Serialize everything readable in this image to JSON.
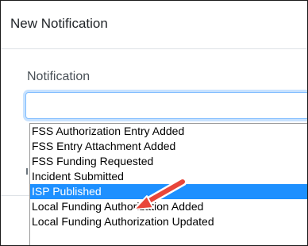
{
  "modal": {
    "title": "New Notification"
  },
  "form": {
    "notification_label": "Notification",
    "notification_value": ""
  },
  "dropdown": {
    "options": [
      "FSS Authorization Entry Added",
      "FSS Entry Attachment Added",
      "FSS Funding Requested",
      "Incident Submitted",
      "ISP Published",
      "Local Funding Authorization Added",
      "Local Funding Authorization Updated"
    ],
    "selected": "ISP Published"
  },
  "colors": {
    "highlight": "#1e90ff",
    "annotation_arrow": "#e8463a",
    "focus_border": "#80bdff"
  },
  "annotation": {
    "icon": "red-arrow-icon"
  }
}
